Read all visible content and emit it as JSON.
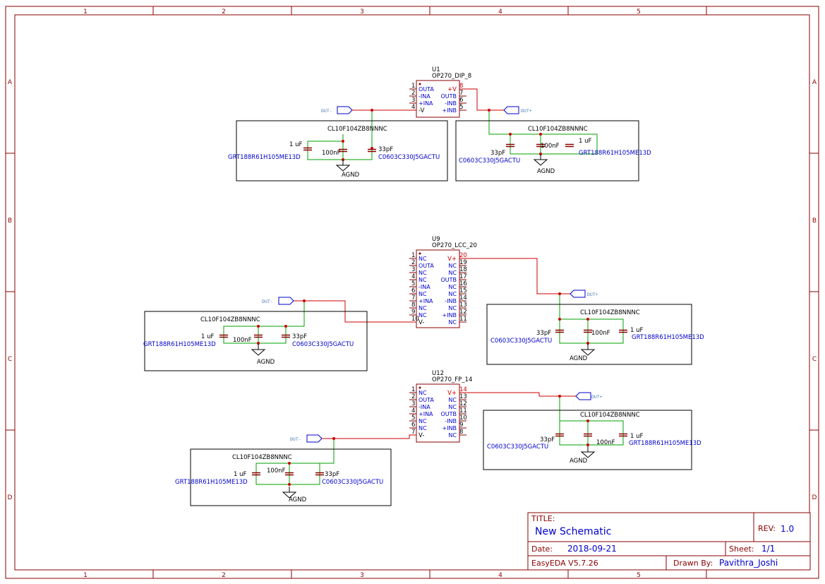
{
  "frame": {
    "columns": [
      "1",
      "2",
      "3",
      "4",
      "5"
    ],
    "rows": [
      "A",
      "B",
      "C",
      "D"
    ]
  },
  "components": {
    "u1": {
      "ref": "U1",
      "part": "OP270_DIP_8",
      "left_pins": [
        {
          "num": "1",
          "name": "OUTA"
        },
        {
          "num": "2",
          "name": "-INA"
        },
        {
          "num": "3",
          "name": "+INA"
        },
        {
          "num": "4",
          "name": "-V"
        }
      ],
      "right_pins": [
        {
          "num": "8",
          "name": "+V"
        },
        {
          "num": "7",
          "name": "OUTB"
        },
        {
          "num": "6",
          "name": "-INB"
        },
        {
          "num": "5",
          "name": "+INB"
        }
      ]
    },
    "u9": {
      "ref": "U9",
      "part": "OP270_LCC_20",
      "left_pins": [
        {
          "num": "1",
          "name": "NC"
        },
        {
          "num": "2",
          "name": "OUTA"
        },
        {
          "num": "3",
          "name": "NC"
        },
        {
          "num": "4",
          "name": "NC"
        },
        {
          "num": "5",
          "name": "-INA"
        },
        {
          "num": "6",
          "name": "NC"
        },
        {
          "num": "7",
          "name": "+INA"
        },
        {
          "num": "8",
          "name": "NC"
        },
        {
          "num": "9",
          "name": "NC"
        },
        {
          "num": "10",
          "name": "V-"
        }
      ],
      "right_pins": [
        {
          "num": "20",
          "name": "V+"
        },
        {
          "num": "19",
          "name": "NC"
        },
        {
          "num": "18",
          "name": "NC"
        },
        {
          "num": "17",
          "name": "OUTB"
        },
        {
          "num": "16",
          "name": "NC"
        },
        {
          "num": "15",
          "name": "NC"
        },
        {
          "num": "14",
          "name": "-INB"
        },
        {
          "num": "13",
          "name": "NC"
        },
        {
          "num": "12",
          "name": "+INB"
        },
        {
          "num": "11",
          "name": "NC"
        }
      ]
    },
    "u12": {
      "ref": "U12",
      "part": "OP270_FP_14",
      "left_pins": [
        {
          "num": "1",
          "name": "NC"
        },
        {
          "num": "2",
          "name": "OUTA"
        },
        {
          "num": "3",
          "name": "-INA"
        },
        {
          "num": "4",
          "name": "+INA"
        },
        {
          "num": "5",
          "name": "NC"
        },
        {
          "num": "6",
          "name": "NC"
        },
        {
          "num": "7",
          "name": "V-"
        }
      ],
      "right_pins": [
        {
          "num": "14",
          "name": "V+"
        },
        {
          "num": "13",
          "name": "NC"
        },
        {
          "num": "12",
          "name": "NC"
        },
        {
          "num": "11",
          "name": "OUTB"
        },
        {
          "num": "10",
          "name": "-INB"
        },
        {
          "num": "9",
          "name": "+INB"
        },
        {
          "num": "8",
          "name": "NC"
        }
      ]
    }
  },
  "labels": {
    "header_part": "CL10F104ZB8NNNC",
    "cap_1uf": "1 uF",
    "cap_100nf": "100nF",
    "cap_33pf": "33pF",
    "part_1uf": "GRT188R61H105ME13D",
    "part_33pf": "C0603C330J5GACTU",
    "agnd": "AGND",
    "dut_minus": "DUT-",
    "dut_plus": "DUT+"
  },
  "title_block": {
    "title_label": "TITLE:",
    "title": "New Schematic",
    "rev_label": "REV:",
    "rev": "1.0",
    "date_label": "Date:",
    "date": "2018-09-21",
    "sheet_label": "Sheet:",
    "sheet": "1/1",
    "software": "EasyEDA V5.7.26",
    "drawn_label": "Drawn By:",
    "drawn_by": "Pavithra_Joshi"
  },
  "colors": {
    "frame": "#8b0000",
    "wire_power": "#cc0000",
    "wire_ground": "#00a000",
    "text_blue": "#0000cc"
  }
}
